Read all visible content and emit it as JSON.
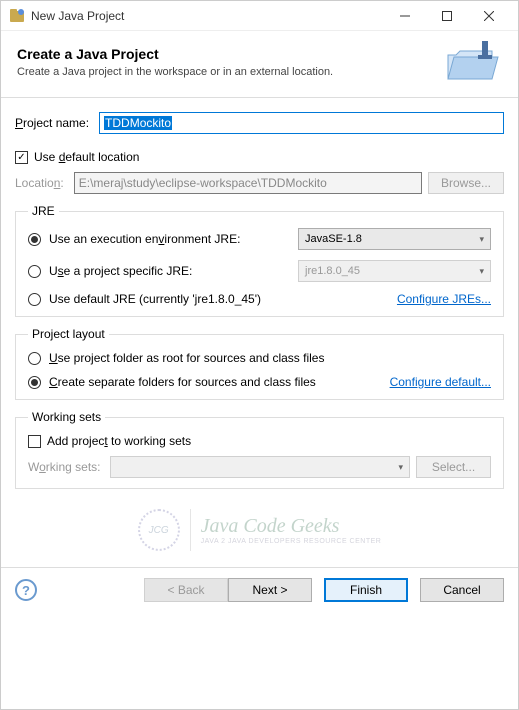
{
  "window": {
    "title": "New Java Project"
  },
  "header": {
    "title": "Create a Java Project",
    "subtitle": "Create a Java project in the workspace or in an external location."
  },
  "projectName": {
    "label": "Project name:",
    "value": "TDDMockito"
  },
  "location": {
    "useDefaultLabel": "Use default location",
    "useDefault": true,
    "label": "Location:",
    "value": "E:\\meraj\\study\\eclipse-workspace\\TDDMockito",
    "browse": "Browse..."
  },
  "jre": {
    "legend": "JRE",
    "option1": "Use an execution environment JRE:",
    "option1Value": "JavaSE-1.8",
    "option2": "Use a project specific JRE:",
    "option2Value": "jre1.8.0_45",
    "option3": "Use default JRE (currently 'jre1.8.0_45')",
    "selected": 1,
    "configure": "Configure JREs..."
  },
  "layout": {
    "legend": "Project layout",
    "option1": "Use project folder as root for sources and class files",
    "option2": "Create separate folders for sources and class files",
    "selected": 2,
    "configure": "Configure default..."
  },
  "workingSets": {
    "legend": "Working sets",
    "addLabel": "Add project to working sets",
    "add": false,
    "label": "Working sets:",
    "select": "Select..."
  },
  "watermark": {
    "badge": "JCG",
    "line1": "Java Code Geeks",
    "line2": "JAVA 2 JAVA DEVELOPERS RESOURCE CENTER"
  },
  "footer": {
    "back": "< Back",
    "next": "Next >",
    "finish": "Finish",
    "cancel": "Cancel"
  }
}
